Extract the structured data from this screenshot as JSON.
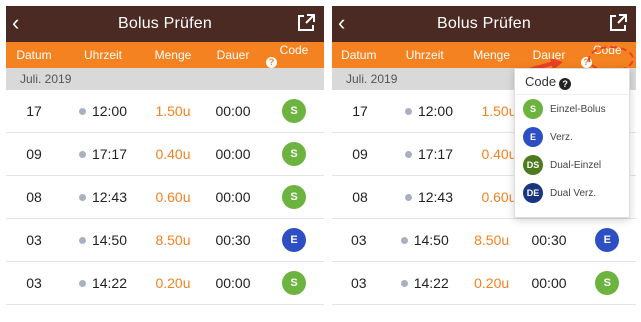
{
  "left": {
    "title": "Bolus Prüfen",
    "columns": [
      "Datum",
      "Uhrzeit",
      "Menge",
      "Dauer",
      "Code"
    ],
    "month": "Juli. 2019",
    "rows": [
      {
        "date": "17",
        "time": "12:00",
        "amount": "1.50u",
        "duration": "00:00",
        "code": "S"
      },
      {
        "date": "09",
        "time": "17:17",
        "amount": "0.40u",
        "duration": "00:00",
        "code": "S"
      },
      {
        "date": "08",
        "time": "12:43",
        "amount": "0.60u",
        "duration": "00:00",
        "code": "S"
      },
      {
        "date": "03",
        "time": "14:50",
        "amount": "8.50u",
        "duration": "00:30",
        "code": "E"
      },
      {
        "date": "03",
        "time": "14:22",
        "amount": "0.20u",
        "duration": "00:00",
        "code": "S"
      }
    ]
  },
  "right": {
    "title": "Bolus Prüfen",
    "columns": [
      "Datum",
      "Uhrzeit",
      "Menge",
      "Dauer",
      "Code"
    ],
    "month": "Juli. 2019",
    "rows": [
      {
        "date": "17",
        "time": "12:00",
        "amount": "1.50u"
      },
      {
        "date": "09",
        "time": "17:17",
        "amount": "0.40u"
      },
      {
        "date": "08",
        "time": "12:43",
        "amount": "0.60u"
      },
      {
        "date": "03",
        "time": "14:50",
        "amount": "8.50u",
        "duration": "00:30",
        "code": "E"
      },
      {
        "date": "03",
        "time": "14:22",
        "amount": "0.20u",
        "duration": "00:00",
        "code": "S"
      }
    ],
    "popup": {
      "title": "Code",
      "items": [
        {
          "code": "S",
          "label": "Einzel-Bolus"
        },
        {
          "code": "E",
          "label": "Verz."
        },
        {
          "code": "DS",
          "label": "Dual-Einzel"
        },
        {
          "code": "DE",
          "label": "Dual Verz."
        }
      ]
    }
  },
  "icons": {
    "back": "chevron-left-icon",
    "external": "external-link-icon",
    "help": "question-circle-icon",
    "clock": "dot-icon"
  },
  "colors": {
    "header_bg": "#4a2a22",
    "column_bar": "#f58220",
    "amount_text": "#f58220",
    "code_s": "#6cb33f",
    "code_e": "#2c4fc4",
    "code_ds": "#4e7a1f",
    "code_de": "#1a3580"
  }
}
